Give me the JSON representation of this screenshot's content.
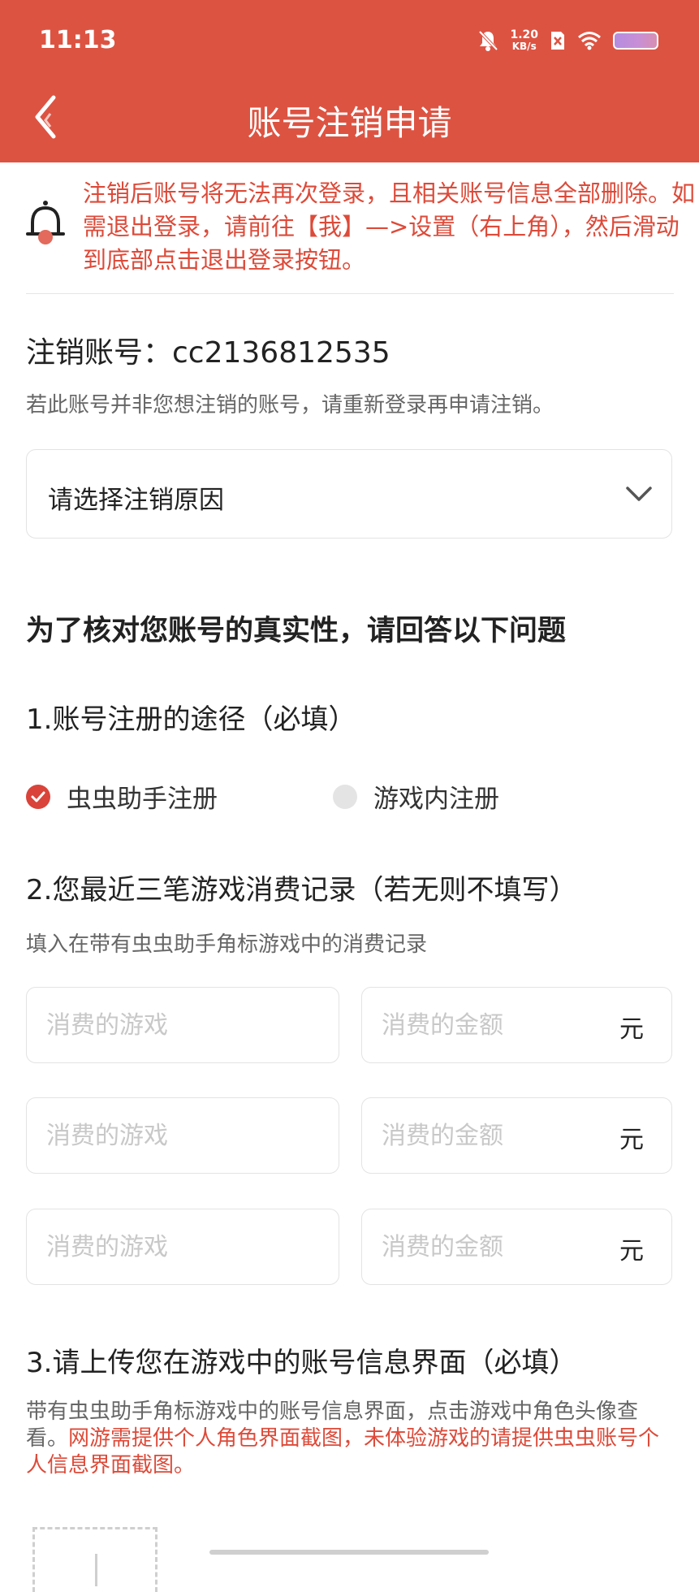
{
  "status_bar": {
    "time": "11:13",
    "net_speed_value": "1.20",
    "net_speed_unit": "KB/s",
    "icons": [
      "mute-bell-icon",
      "sim-x-icon",
      "wifi-icon",
      "battery-icon"
    ]
  },
  "header": {
    "title": "账号注销申请",
    "back_icon": "chevron-left-icon"
  },
  "notice": {
    "icon": "bell-icon",
    "text": "注销后账号将无法再次登录，且相关账号信息全部删除。如需退出登录，请前往【我】—>设置（右上角），然后滑动到底部点击退出登录按钮。"
  },
  "account": {
    "label": "注销账号：cc2136812535",
    "hint": "若此账号并非您想注销的账号，请重新登录再申请注销。"
  },
  "reason_select": {
    "label": "请选择注销原因",
    "icon": "chevron-down-icon"
  },
  "verify": {
    "title": "为了核对您账号的真实性，请回答以下问题"
  },
  "q1": {
    "title": "1.账号注册的途径（必填）",
    "options": [
      {
        "label": "虫虫助手注册",
        "checked": true
      },
      {
        "label": "游戏内注册",
        "checked": false
      }
    ]
  },
  "q2": {
    "title": "2.您最近三笔游戏消费记录（若无则不填写）",
    "hint": "填入在带有虫虫助手角标游戏中的消费记录",
    "rows": [
      {
        "game_placeholder": "消费的游戏",
        "amount_placeholder": "消费的金额",
        "unit": "元"
      },
      {
        "game_placeholder": "消费的游戏",
        "amount_placeholder": "消费的金额",
        "unit": "元"
      },
      {
        "game_placeholder": "消费的游戏",
        "amount_placeholder": "消费的金额",
        "unit": "元"
      }
    ]
  },
  "q3": {
    "title": "3.请上传您在游戏中的账号信息界面（必填）",
    "hint_normal": "带有虫虫助手角标游戏中的账号信息界面，点击游戏中角色头像查看。",
    "hint_red": "网游需提供个人角色界面截图，未体验游戏的请提供虫虫账号个人信息界面截图。"
  },
  "colors": {
    "header": "#dd5342",
    "accent": "#d9433a",
    "warning_text": "#dd4a39"
  }
}
